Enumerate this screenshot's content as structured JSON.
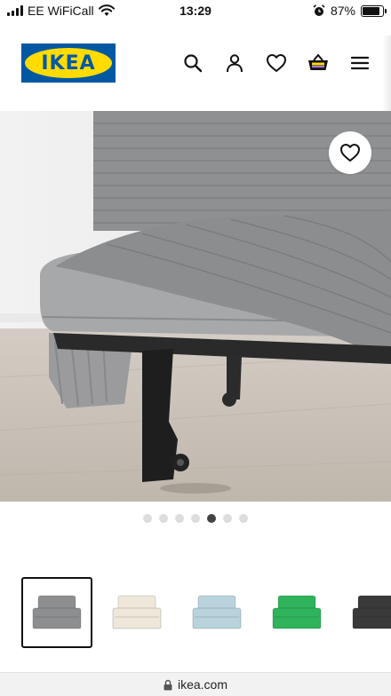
{
  "status_bar": {
    "carrier": "EE WiFiCall",
    "time": "13:29",
    "battery_percent": "87%",
    "battery_level": 0.87,
    "icons": [
      "signal-icon",
      "wifi-icon",
      "alarm-icon",
      "battery-icon"
    ]
  },
  "header": {
    "logo_text": "IKEA",
    "icons": [
      "search-icon",
      "account-icon",
      "wishlist-icon",
      "basket-icon",
      "menu-icon"
    ]
  },
  "product_image": {
    "favourite_icon": "heart-icon"
  },
  "carousel": {
    "total": 7,
    "active_index": 4
  },
  "variants": [
    {
      "color": "#8d8e90",
      "selected": true
    },
    {
      "color": "#efe8da",
      "selected": false
    },
    {
      "color": "#b9d3dc",
      "selected": false
    },
    {
      "color": "#2fb35b",
      "selected": false
    },
    {
      "color": "#3a3a3a",
      "selected": false
    }
  ],
  "url_bar": {
    "domain": "ikea.com",
    "icon": "lock-icon"
  },
  "colors": {
    "brand_blue": "#0058a3",
    "brand_yellow": "#ffdb00"
  }
}
